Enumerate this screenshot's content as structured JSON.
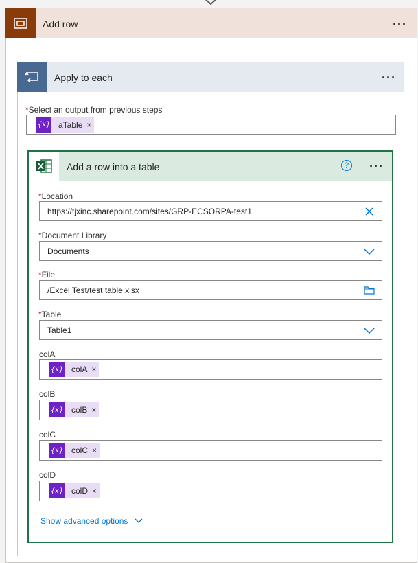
{
  "scope": {
    "title": "Add row",
    "icon": "scope-icon",
    "color": "#8a3b0a"
  },
  "apply": {
    "title": "Apply to each",
    "icon": "loop-icon",
    "color": "#486991",
    "output_label": "Select an output from previous steps",
    "output_token": "aTable"
  },
  "excel": {
    "title": "Add a row into a table",
    "icon": "excel-icon",
    "color": "#217346",
    "location_label": "Location",
    "location_value": "https://tjxinc.sharepoint.com/sites/GRP-ECSORPA-test1",
    "library_label": "Document Library",
    "library_value": "Documents",
    "file_label": "File",
    "file_value": "/Excel Test/test table.xlsx",
    "table_label": "Table",
    "table_value": "Table1",
    "colA_label": "colA",
    "colA_token": "colA",
    "colB_label": "colB",
    "colB_token": "colB",
    "colC_label": "colC",
    "colC_token": "colC",
    "colD_label": "colD",
    "colD_token": "colD",
    "advanced": "Show advanced options"
  },
  "token_icon_text": "{x}",
  "required_mark": "*",
  "remove_mark": "×"
}
